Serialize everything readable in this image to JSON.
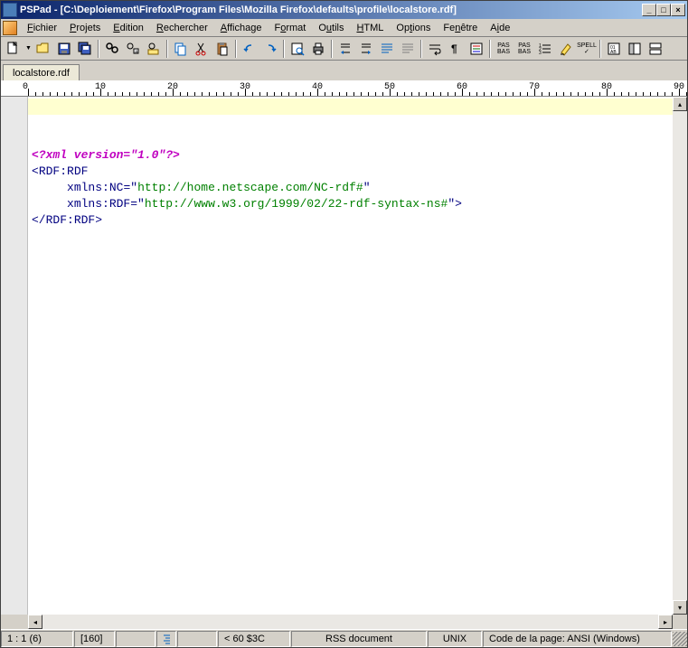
{
  "title": "PSPad - [C:\\Deploiement\\Firefox\\Program Files\\Mozilla Firefox\\defaults\\profile\\localstore.rdf]",
  "menu": {
    "fichier": "Fichier",
    "projets": "Projets",
    "edition": "Edition",
    "rechercher": "Rechercher",
    "affichage": "Affichage",
    "format": "Format",
    "outils": "Outils",
    "html": "HTML",
    "options": "Options",
    "fenetre": "Fenêtre",
    "aide": "Aide"
  },
  "tab": {
    "filename": "localstore.rdf"
  },
  "ruler": {
    "marks": [
      0,
      10,
      20,
      30,
      40,
      50,
      60,
      70,
      80,
      90
    ]
  },
  "code": {
    "line1": "<?xml version=\"1.0\"?>",
    "line2_open": "<",
    "line2_tag": "RDF:RDF",
    "line3_attr": "xmlns:NC",
    "line3_eq": "=",
    "line3_q": "\"",
    "line3_val": "http://home.netscape.com/NC-rdf#",
    "line4_attr": "xmlns:RDF",
    "line4_eq": "=",
    "line4_q": "\"",
    "line4_val": "http://www.w3.org/1999/02/22-rdf-syntax-ns#",
    "line4_close": ">",
    "line5_open": "</",
    "line5_tag": "RDF:RDF",
    "line5_close": ">"
  },
  "status": {
    "pos": "1 : 1  (6)",
    "brk": "[160]",
    "char": "<  60 $3C",
    "doctype": "RSS document",
    "eol": "UNIX",
    "encoding": "Code de la page: ANSI (Windows)"
  }
}
